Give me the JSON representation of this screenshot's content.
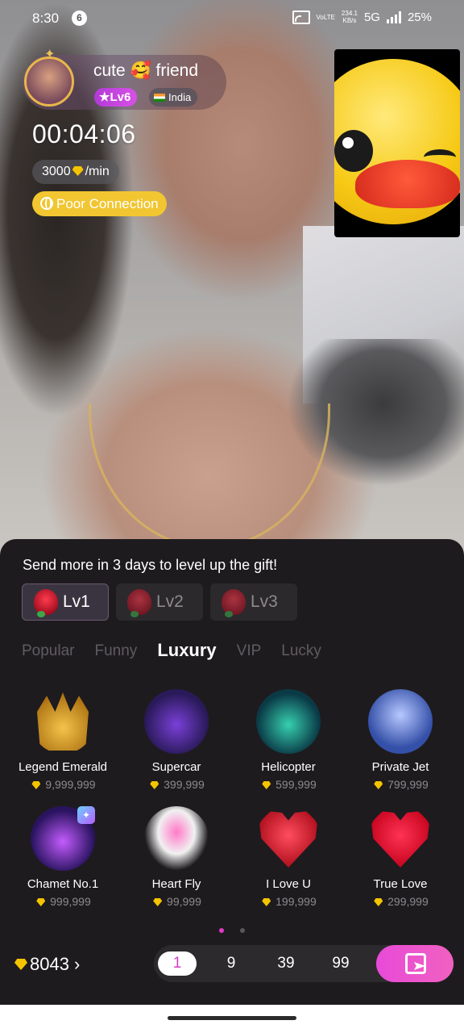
{
  "status_bar": {
    "time": "8:30",
    "notification_count": "6",
    "volte": "VoLTE",
    "speed_value": "234.1",
    "speed_unit": "KB/s",
    "network": "5G",
    "battery": "25%"
  },
  "host": {
    "name": "cute 🥰 friend",
    "level": "Lv6",
    "country": "India",
    "call_timer": "00:04:06",
    "rate_amount": "3000",
    "rate_unit": "/min",
    "connection_status": "Poor Connection"
  },
  "gift_panel": {
    "hint": "Send more in 3 days to level up the gift!",
    "level_tabs": [
      {
        "label": "Lv1",
        "active": true
      },
      {
        "label": "Lv2",
        "active": false
      },
      {
        "label": "Lv3",
        "active": false
      }
    ],
    "categories": [
      {
        "label": "Popular",
        "active": false
      },
      {
        "label": "Funny",
        "active": false
      },
      {
        "label": "Luxury",
        "active": true
      },
      {
        "label": "VIP",
        "active": false
      },
      {
        "label": "Lucky",
        "active": false
      }
    ],
    "gifts": [
      {
        "name": "Legend Emerald",
        "price": "9,999,999",
        "icon": "crown-icon"
      },
      {
        "name": "Supercar",
        "price": "399,999",
        "icon": "supercar-icon"
      },
      {
        "name": "Helicopter",
        "price": "599,999",
        "icon": "helicopter-icon"
      },
      {
        "name": "Private Jet",
        "price": "799,999",
        "icon": "jet-icon"
      },
      {
        "name": "Chamet No.1",
        "price": "999,999",
        "icon": "castle-icon"
      },
      {
        "name": "Heart Fly",
        "price": "99,999",
        "icon": "winged-heart-icon"
      },
      {
        "name": "I Love U",
        "price": "199,999",
        "icon": "heart-icon"
      },
      {
        "name": "True Love",
        "price": "299,999",
        "icon": "love-heart-icon"
      }
    ],
    "balance": "8043",
    "quantities": [
      "1",
      "9",
      "39",
      "99"
    ],
    "selected_quantity": "1"
  },
  "colors": {
    "accent_pink": "#e84ad8",
    "gem_gold": "#f5c400",
    "connection_yellow": "#f1c631",
    "panel_bg": "#1e1b1f"
  }
}
